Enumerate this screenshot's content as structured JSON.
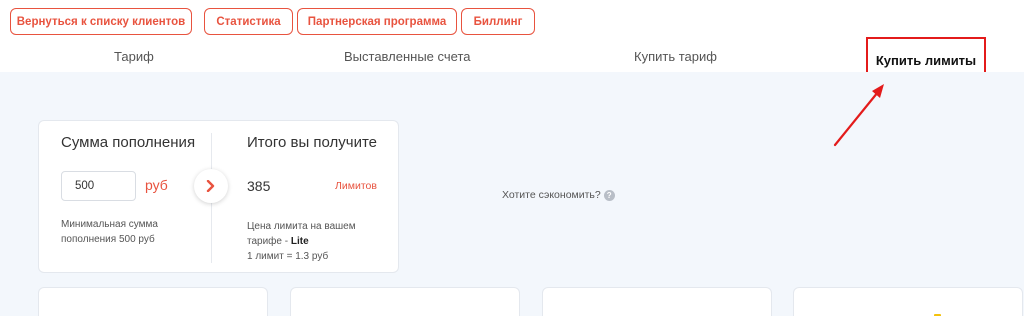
{
  "topnav": {
    "back_label": "Вернуться к списку клиентов",
    "stats_label": "Статистика",
    "partner_label": "Партнерская программа",
    "billing_label": "Биллинг"
  },
  "tabs": {
    "tariff": "Тариф",
    "invoices": "Выставленные счета",
    "buy_tariff": "Купить тариф",
    "buy_limits": "Купить лимиты"
  },
  "topup": {
    "amount_heading": "Сумма пополнения",
    "result_heading": "Итого вы получите",
    "amount_value": "500",
    "currency": "руб",
    "result_value": "385",
    "result_unit": "Лимитов",
    "min_note": "Минимальная сумма пополнения 500 руб",
    "price_note_prefix": "Цена лимита на вашем тарифе - ",
    "tariff_name": "Lite",
    "price_note_rate": "1 лимит = 1.3 руб"
  },
  "save": {
    "text": "Хотите сэкономить?",
    "help_glyph": "?"
  },
  "colors": {
    "accent": "#e8533f",
    "annotation": "#e31b1b",
    "panel_bg": "#f3f7fc"
  },
  "icons": {
    "arrow": "chevron-right-icon",
    "help": "question-icon"
  }
}
